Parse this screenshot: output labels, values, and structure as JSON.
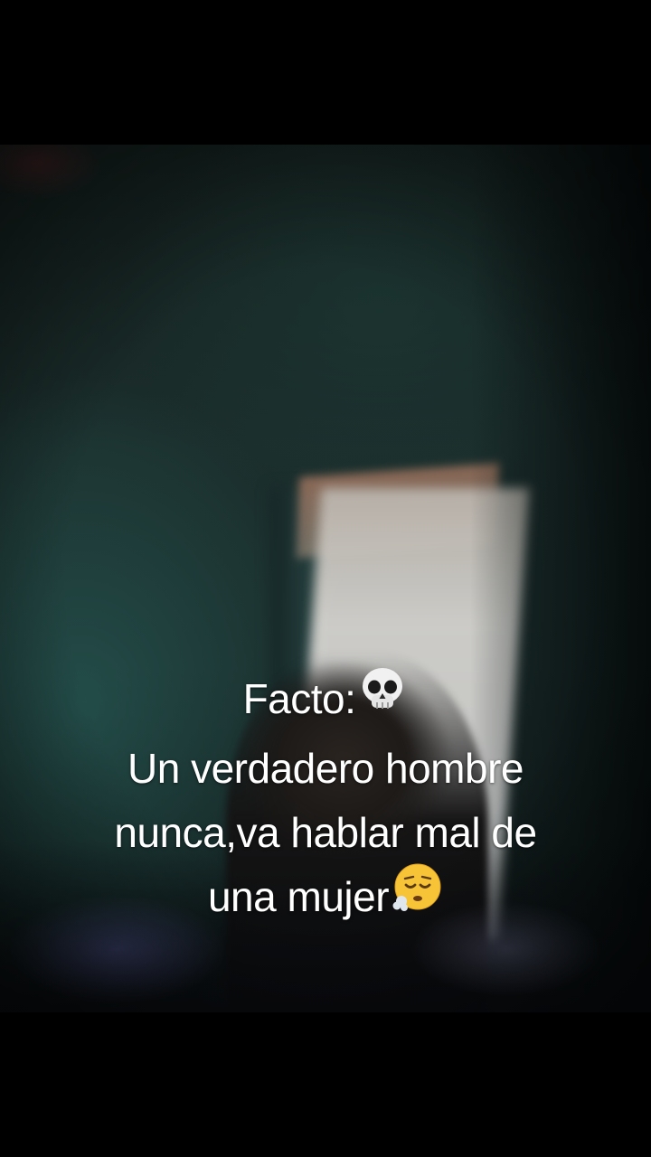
{
  "caption": {
    "line1": "Facto:",
    "line2": "Un verdadero hombre",
    "line3": "nunca,va hablar mal de",
    "line4": "una mujer",
    "emoji1": "skull-emoji",
    "emoji2": "exhaling-face-emoji"
  }
}
